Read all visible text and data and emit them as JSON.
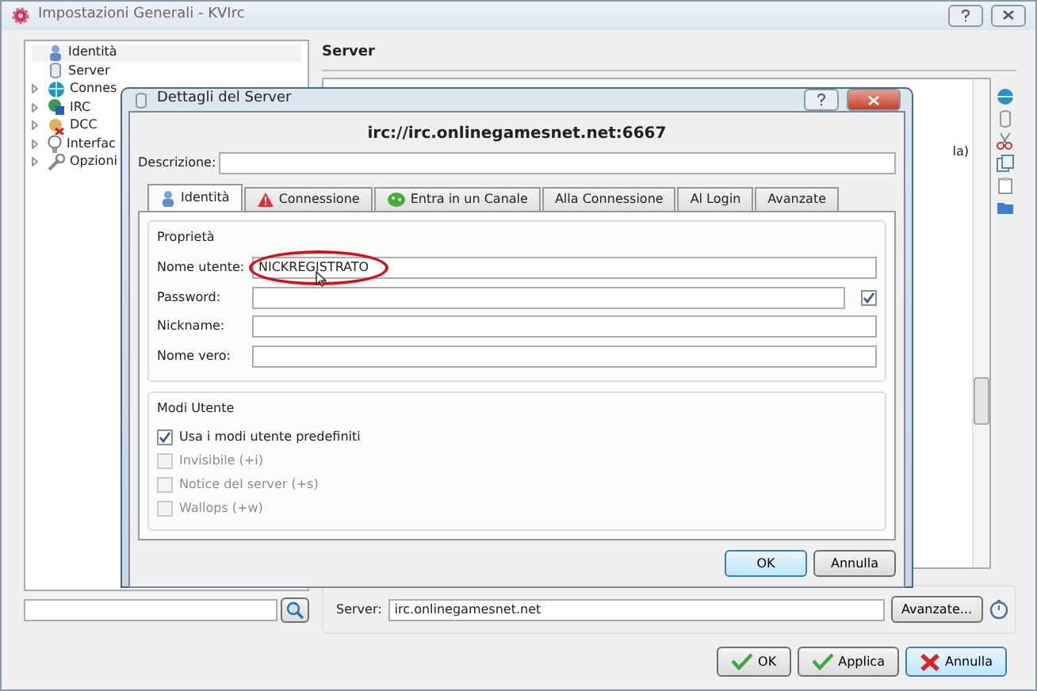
{
  "main_window": {
    "title": "Impostazioni Generali - KVIrc",
    "tree": [
      {
        "label": "Identità",
        "expandable": false,
        "selected": true
      },
      {
        "label": "Server",
        "expandable": false,
        "selected": false
      },
      {
        "label": "Connes",
        "expandable": true,
        "selected": false
      },
      {
        "label": "IRC",
        "expandable": true,
        "selected": false
      },
      {
        "label": "DCC",
        "expandable": true,
        "selected": false
      },
      {
        "label": "Interfac",
        "expandable": true,
        "selected": false
      },
      {
        "label": "Opzioni",
        "expandable": true,
        "selected": false
      }
    ],
    "section_title": "Server",
    "list_fragment": "la)",
    "server_label": "Server:",
    "server_value": "irc.onlinegamesnet.net",
    "advanced_button": "Avanzate...",
    "buttons": [
      {
        "label": "OK",
        "kind": "ok"
      },
      {
        "label": "Applica",
        "kind": "ok"
      },
      {
        "label": "Annulla",
        "kind": "cancel"
      }
    ]
  },
  "dialog": {
    "title": "Dettagli del Server",
    "heading": "irc://irc.onlinegamesnet.net:6667",
    "description_label": "Descrizione:",
    "tabs": [
      {
        "label": "Identità",
        "selected": true
      },
      {
        "label": "Connessione",
        "selected": false
      },
      {
        "label": "Entra in un Canale",
        "selected": false
      },
      {
        "label": "Alla Connessione",
        "selected": false
      },
      {
        "label": "Al Login",
        "selected": false
      },
      {
        "label": "Avanzate",
        "selected": false
      }
    ],
    "properties": {
      "title": "Proprietà",
      "fields": [
        {
          "label": "Nome utente:",
          "value": "NICKREGISTRATO",
          "highlighted": true
        },
        {
          "label": "Password:",
          "checkbox": {
            "checked": true
          }
        },
        {
          "label": "Nickname:"
        },
        {
          "label": "Nome vero:"
        }
      ]
    },
    "user_modes": {
      "title": "Modi Utente",
      "options": [
        {
          "label": "Usa i modi utente predefiniti",
          "checked": true,
          "disabled": false
        },
        {
          "label": "Invisibile (+i)",
          "checked": false,
          "disabled": true
        },
        {
          "label": "Notice del server (+s)",
          "checked": false,
          "disabled": true
        },
        {
          "label": "Wallops (+w)",
          "checked": false,
          "disabled": true
        }
      ]
    },
    "buttons": [
      {
        "label": "OK",
        "default": true
      },
      {
        "label": "Annulla",
        "default": false
      }
    ]
  }
}
